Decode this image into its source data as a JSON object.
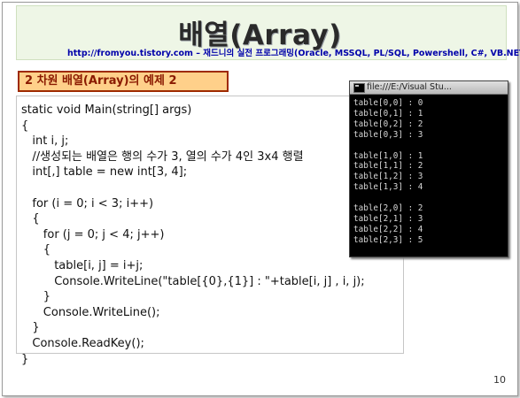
{
  "slide": {
    "title": "배열(Array)",
    "url": "http://fromyou.tistory.com",
    "separator": "–",
    "url_desc": "재드니의 실전 프로그래밍(Oracle, MSSQL, PL/SQL, Powershell, C#, VB.NET)",
    "subtitle": "2 차원 배열(Array)의 예제 2",
    "page_number": "10"
  },
  "code": {
    "lines": [
      "static void Main(string[] args)",
      "{",
      "   int i, j;",
      "   //생성되는 배열은 행의 수가 3, 열의 수가 4인 3x4 행렬",
      "   int[,] table = new int[3, 4];",
      "",
      "   for (i = 0; i < 3; i++)",
      "   {",
      "      for (j = 0; j < 4; j++)",
      "      {",
      "         table[i, j] = i+j;",
      "         Console.WriteLine(\"table[{0},{1}] : \"+table[i, j] , i, j);",
      "      }",
      "      Console.WriteLine();",
      "   }",
      "   Console.ReadKey();",
      "}"
    ]
  },
  "console": {
    "title": "file:///E:/Visual Stu...",
    "lines": [
      "table[0,0] : 0",
      "table[0,1] : 1",
      "table[0,2] : 2",
      "table[0,3] : 3",
      "",
      "table[1,0] : 1",
      "table[1,1] : 2",
      "table[1,2] : 3",
      "table[1,3] : 4",
      "",
      "table[2,0] : 2",
      "table[2,1] : 3",
      "table[2,2] : 4",
      "table[2,3] : 5"
    ]
  }
}
